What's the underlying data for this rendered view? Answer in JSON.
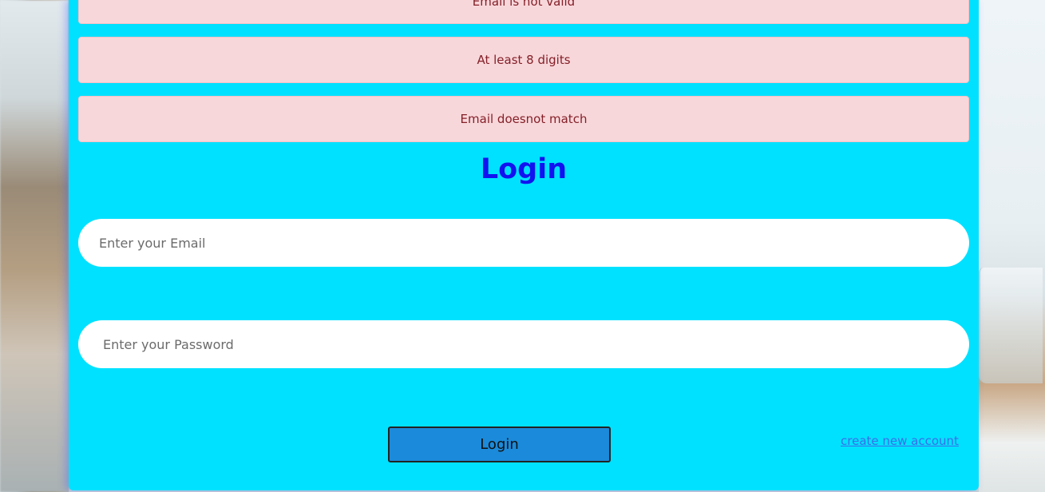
{
  "alerts": [
    {
      "message": "Email is not valid"
    },
    {
      "message": "At least 8 digits"
    },
    {
      "message": "Email doesnot match"
    }
  ],
  "login_form": {
    "title": "Login",
    "email_placeholder": "Enter your Email",
    "password_placeholder": "Enter your Password",
    "submit_label": "Login",
    "create_account_link": "create new account"
  },
  "colors": {
    "card_background": "#00e1ff",
    "title": "#1212f0",
    "alert_background": "#f8d7da",
    "alert_text": "#842029",
    "button_background": "#1b8ada",
    "link": "#3a6ee8"
  }
}
